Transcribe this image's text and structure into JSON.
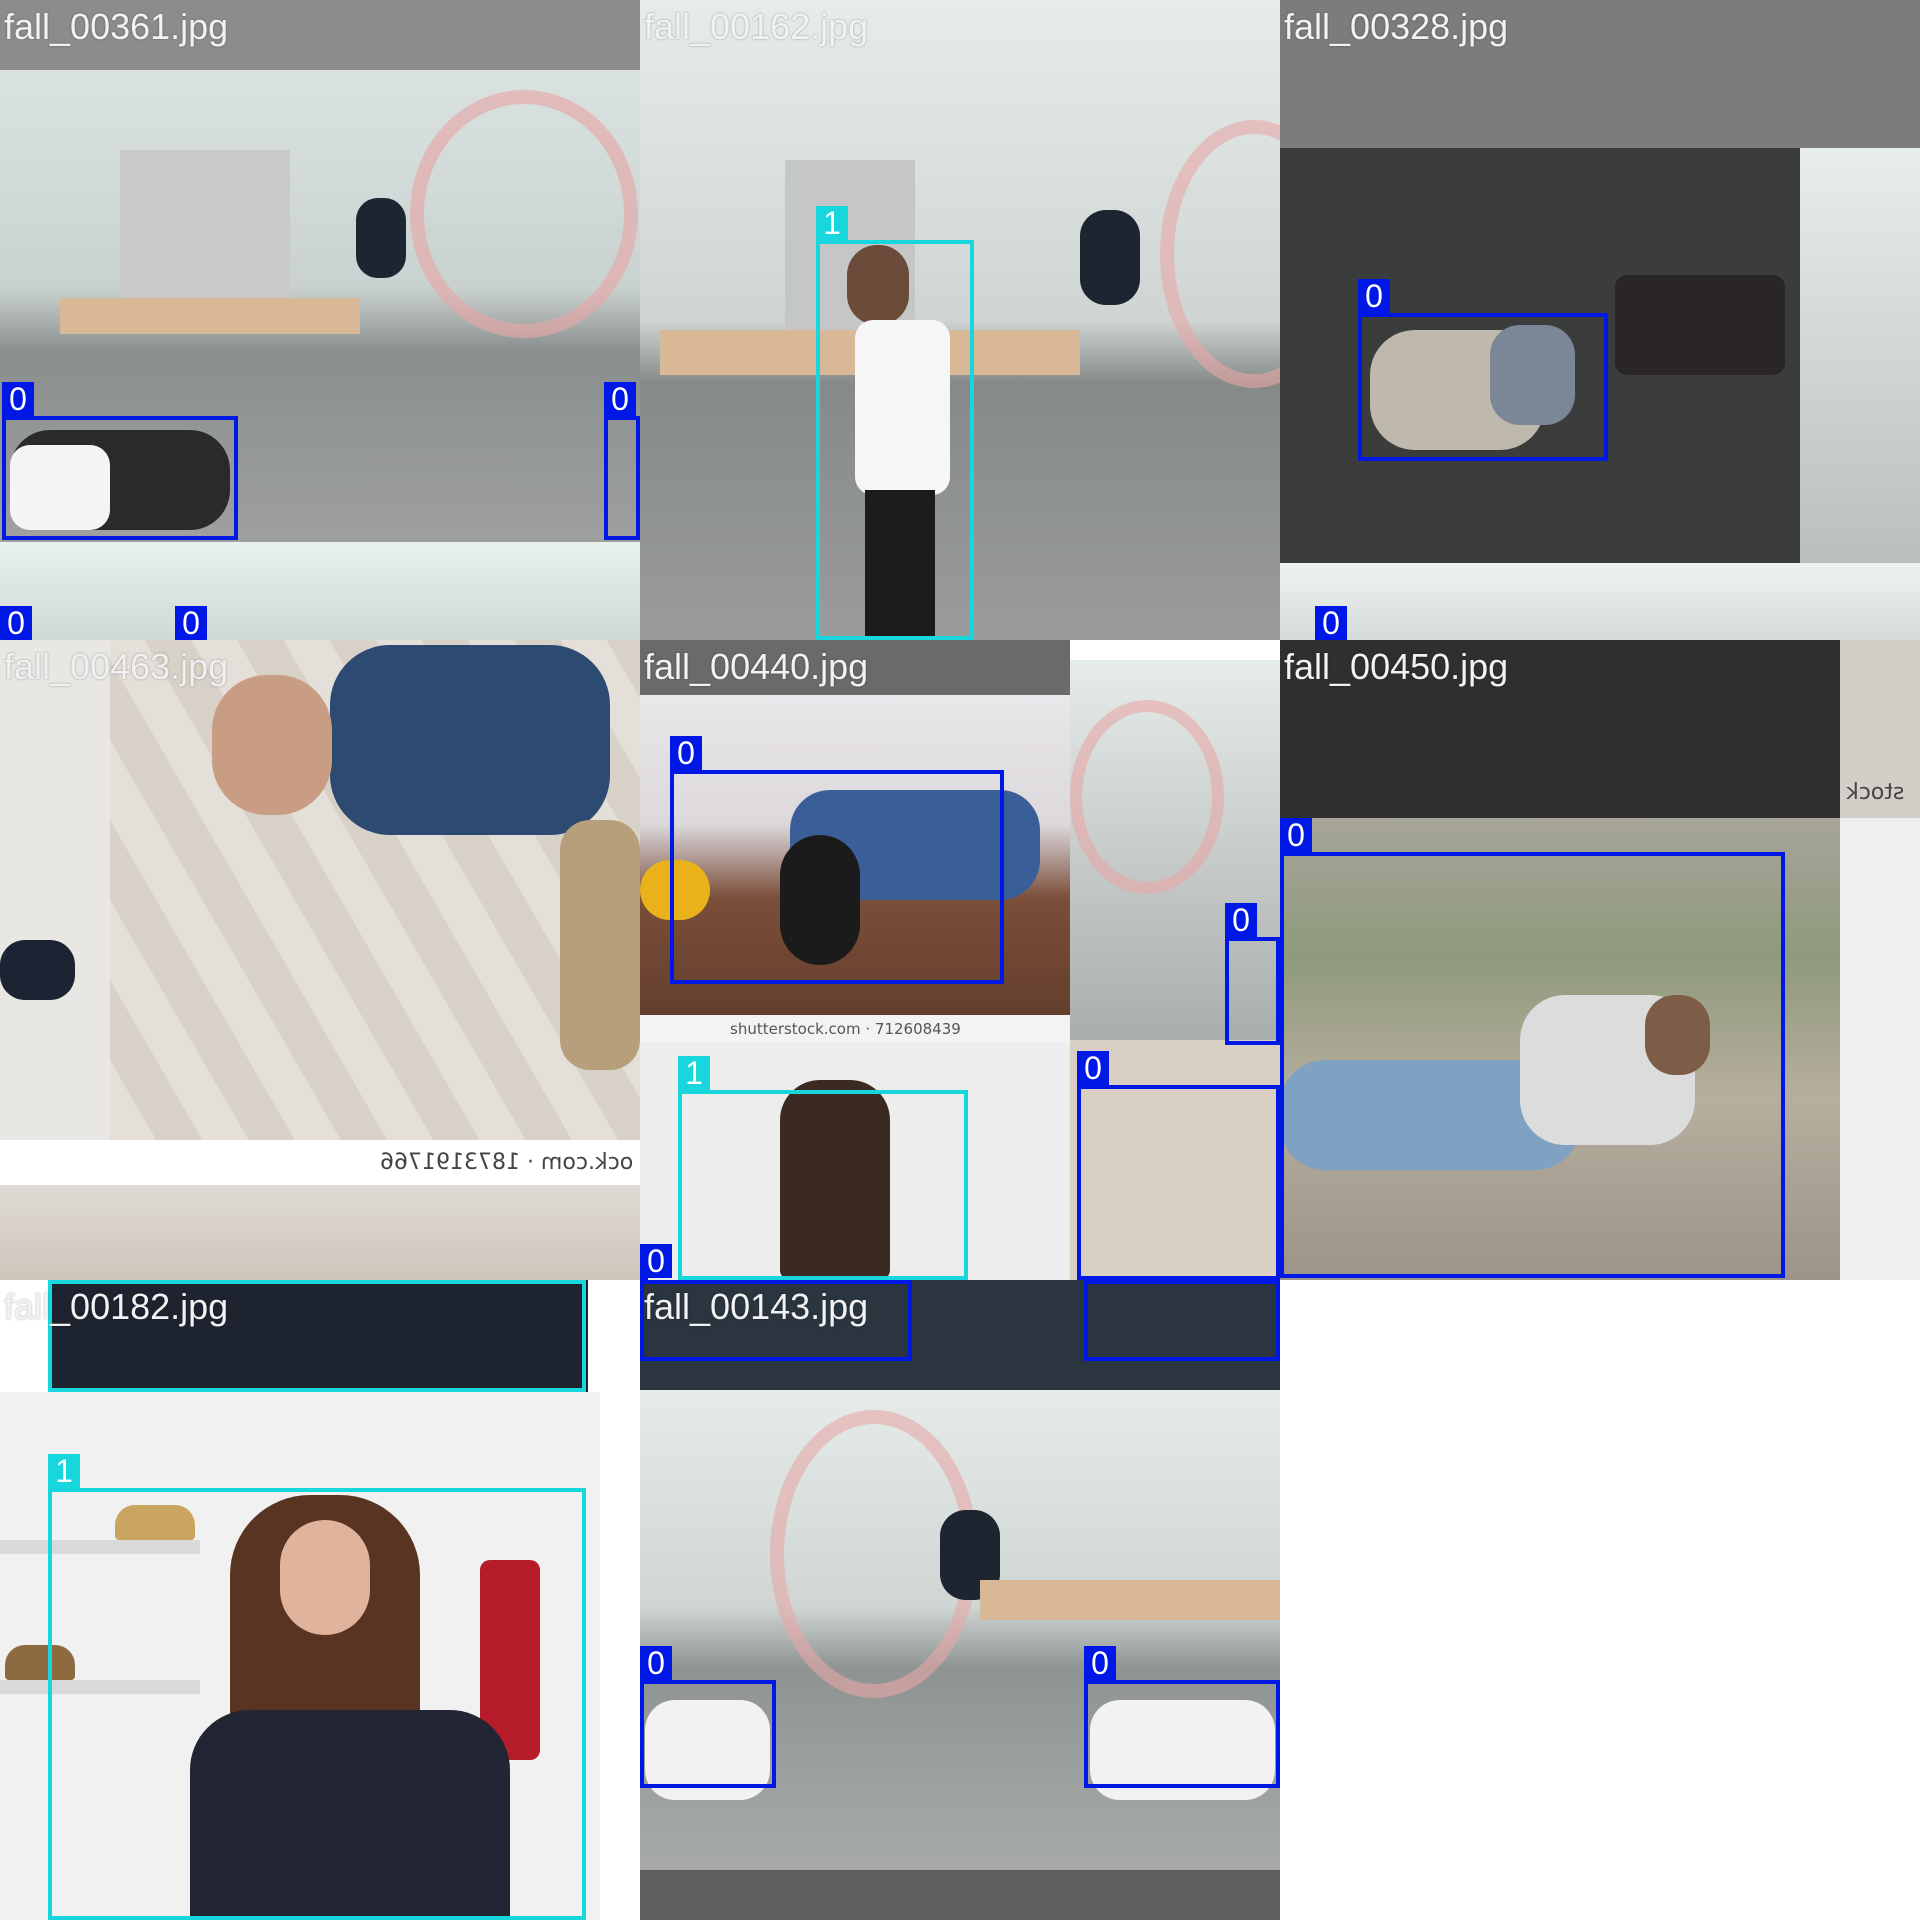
{
  "colors": {
    "class_0": "#0018e6",
    "class_1": "#17d6dc"
  },
  "tiles": [
    {
      "title": "fall_00361.jpg",
      "boxes": [
        "0",
        "0",
        "0",
        "0"
      ]
    },
    {
      "title": "fall_00162.jpg",
      "boxes": [
        "1"
      ]
    },
    {
      "title": "fall_00328.jpg",
      "boxes": [
        "0",
        "0"
      ]
    },
    {
      "title": "fall_00463.jpg",
      "boxes": [
        "0"
      ],
      "watermark": "ock.com · 1873191766"
    },
    {
      "title": "fall_00440.jpg",
      "boxes": [
        "0",
        "0",
        "1",
        "0",
        "0"
      ],
      "watermark": "shutterstock.com · 712608439"
    },
    {
      "title": "fall_00450.jpg",
      "boxes": [
        "0",
        "0"
      ],
      "watermark": "stock"
    },
    {
      "title": "fall_00182.jpg",
      "boxes": [
        "1",
        "1"
      ]
    },
    {
      "title": "fall_00143.jpg",
      "boxes": [
        "0",
        "0",
        "0",
        "0"
      ]
    }
  ]
}
